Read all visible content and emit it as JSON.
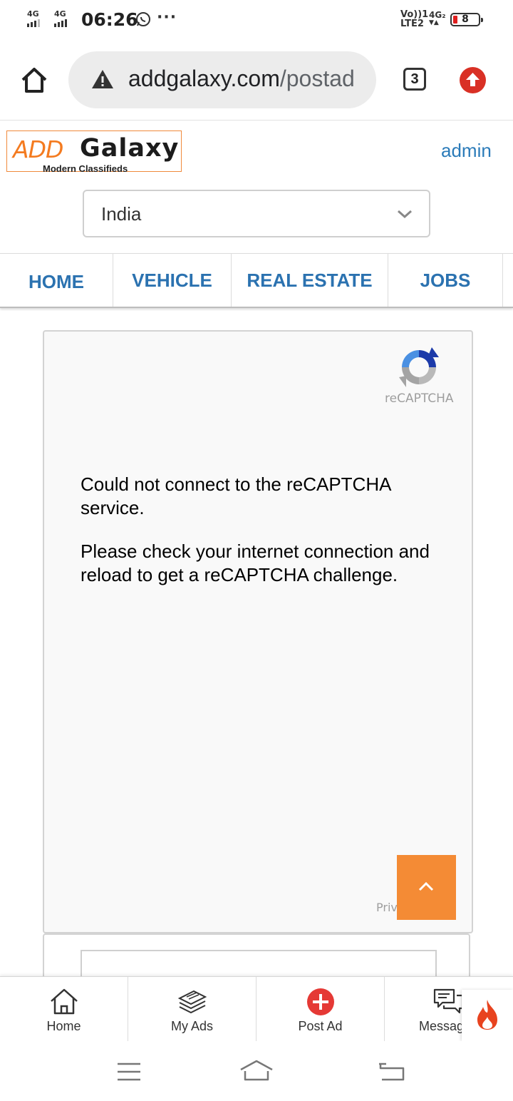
{
  "status_bar": {
    "sim1_network": "4G",
    "sim2_network": "4G",
    "time": "06:26",
    "overflow": "···",
    "volte_line1": "Vo))1",
    "volte_line2": "LTE2",
    "net_right": "4G₂",
    "battery_level": "8",
    "icons": [
      "whatsapp-icon",
      "battery-icon"
    ]
  },
  "browser": {
    "url_host": "addgalaxy.com",
    "url_path": "/postad",
    "tab_count": "3",
    "icons": [
      "home-icon",
      "warning-icon",
      "update-icon"
    ]
  },
  "site": {
    "logo_add": "ADD",
    "logo_galaxy": "Galaxy",
    "logo_tagline": "Modern Classifieds",
    "admin_link": "admin",
    "country_selected": "India"
  },
  "nav": {
    "items": [
      {
        "label": "HOME"
      },
      {
        "label": "VEHICLE"
      },
      {
        "label": "REAL ESTATE"
      },
      {
        "label": "JOBS"
      }
    ]
  },
  "recaptcha": {
    "brand": "reCAPTCHA",
    "message1": "Could not connect to the reCAPTCHA service.",
    "message2": "Please check your internet connection and reload to get a reCAPTCHA challenge.",
    "privacy_partial": "Priv"
  },
  "bottom_bar": {
    "items": [
      {
        "label": "Home",
        "icon": "house-icon"
      },
      {
        "label": "My Ads",
        "icon": "stack-icon"
      },
      {
        "label": "Post Ad",
        "icon": "plus-circle-icon"
      },
      {
        "label": "Messag",
        "icon": "chat-icon"
      }
    ]
  },
  "colors": {
    "brand_orange": "#f47b20",
    "link_blue": "#2b72b0",
    "scroll_top_orange": "#f48b35",
    "post_ad_red": "#e53935"
  }
}
